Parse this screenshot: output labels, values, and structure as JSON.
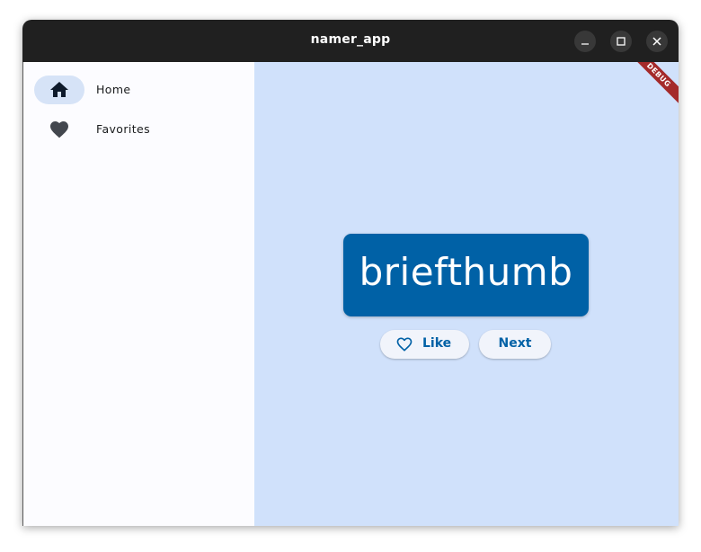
{
  "window": {
    "title": "namer_app",
    "controls": {
      "minimize_icon": "minimize-icon",
      "maximize_icon": "maximize-icon",
      "close_icon": "close-icon"
    }
  },
  "sidebar": {
    "items": [
      {
        "label": "Home",
        "icon": "home-icon",
        "selected": true
      },
      {
        "label": "Favorites",
        "icon": "heart-icon",
        "selected": false
      }
    ]
  },
  "main": {
    "word": "briefthumb",
    "like_button": {
      "label": "Like",
      "icon": "heart-outline-icon"
    },
    "next_button": {
      "label": "Next"
    },
    "debug_banner": "DEBUG"
  },
  "colors": {
    "titlebar": "#202020",
    "main_background": "#d0e1fb",
    "card": "#0061a6",
    "accent": "#0061a6",
    "rail_indicator": "#d6e3f7",
    "debug_banner": "#a42a2a"
  }
}
